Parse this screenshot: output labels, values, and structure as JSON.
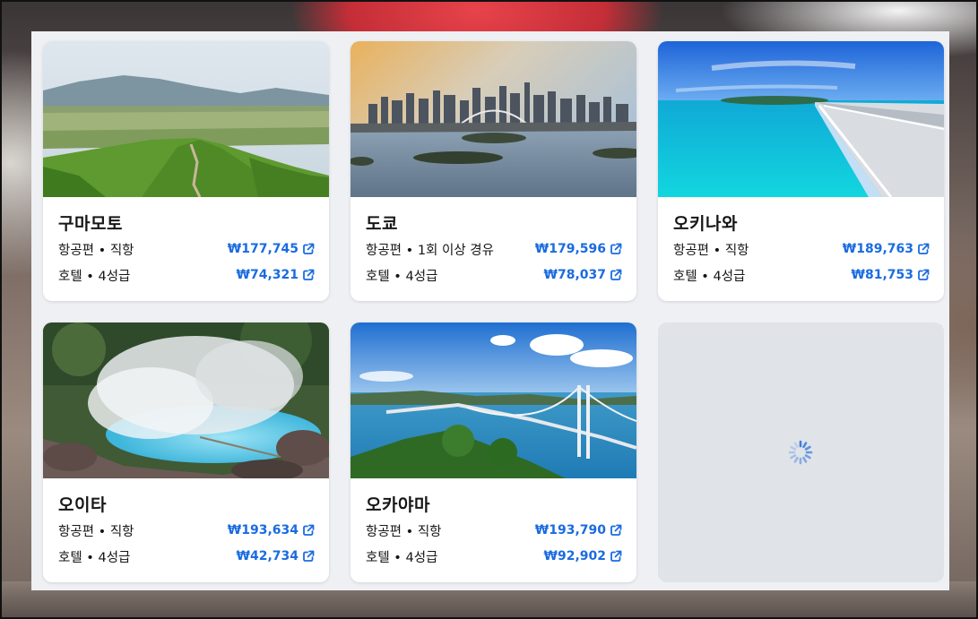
{
  "colors": {
    "price": "#1a6be0",
    "panel": "#eef0f3",
    "placeholder": "#e0e3e8"
  },
  "icons": {
    "price_link": "external-link-icon",
    "loading": "loading-spinner-icon"
  },
  "destinations": [
    {
      "city": "구마모토",
      "flight_label": "항공편",
      "flight_detail": "직항",
      "flight_price": "₩177,745",
      "hotel_label": "호텔",
      "hotel_detail": "4성급",
      "hotel_price": "₩74,321"
    },
    {
      "city": "도쿄",
      "flight_label": "항공편",
      "flight_detail": "1회 이상 경유",
      "flight_price": "₩179,596",
      "hotel_label": "호텔",
      "hotel_detail": "4성급",
      "hotel_price": "₩78,037"
    },
    {
      "city": "오키나와",
      "flight_label": "항공편",
      "flight_detail": "직항",
      "flight_price": "₩189,763",
      "hotel_label": "호텔",
      "hotel_detail": "4성급",
      "hotel_price": "₩81,753"
    },
    {
      "city": "오이타",
      "flight_label": "항공편",
      "flight_detail": "직항",
      "flight_price": "₩193,634",
      "hotel_label": "호텔",
      "hotel_detail": "4성급",
      "hotel_price": "₩42,734"
    },
    {
      "city": "오카야마",
      "flight_label": "항공편",
      "flight_detail": "직항",
      "flight_price": "₩193,790",
      "hotel_label": "호텔",
      "hotel_detail": "4성급",
      "hotel_price": "₩92,902"
    }
  ]
}
